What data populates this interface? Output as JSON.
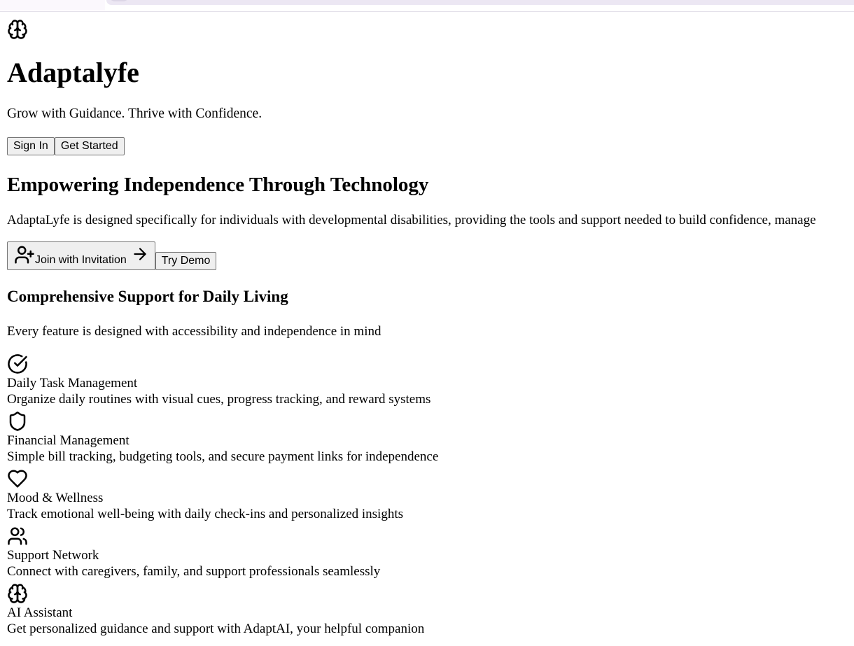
{
  "app": {
    "logo_icon": "brain-icon",
    "title": "Adaptalyfe",
    "tagline": "Grow with Guidance. Thrive with Confidence."
  },
  "header_buttons": {
    "sign_in": "Sign In",
    "get_started": "Get Started"
  },
  "hero": {
    "title": "Empowering Independence Through Technology",
    "description": "AdaptaLyfe is designed specifically for individuals with developmental disabilities, providing the tools and support needed to build confidence, manage",
    "join_button": "Join with Invitation",
    "join_icon": "user-plus-icon",
    "join_arrow_icon": "arrow-right-icon",
    "demo_button": "Try Demo"
  },
  "features_section": {
    "title": "Comprehensive Support for Daily Living",
    "subtitle": "Every feature is designed with accessibility and independence in mind",
    "items": [
      {
        "icon": "check-circle-icon",
        "title": "Daily Task Management",
        "description": "Organize daily routines with visual cues, progress tracking, and reward systems"
      },
      {
        "icon": "shield-icon",
        "title": "Financial Management",
        "description": "Simple bill tracking, budgeting tools, and secure payment links for independence"
      },
      {
        "icon": "heart-icon",
        "title": "Mood & Wellness",
        "description": "Track emotional well-being with daily check-ins and personalized insights"
      },
      {
        "icon": "users-icon",
        "title": "Support Network",
        "description": "Connect with caregivers, family, and support professionals seamlessly"
      },
      {
        "icon": "brain-icon",
        "title": "AI Assistant",
        "description": "Get personalized guidance and support with AdaptAI, your helpful companion"
      }
    ]
  }
}
